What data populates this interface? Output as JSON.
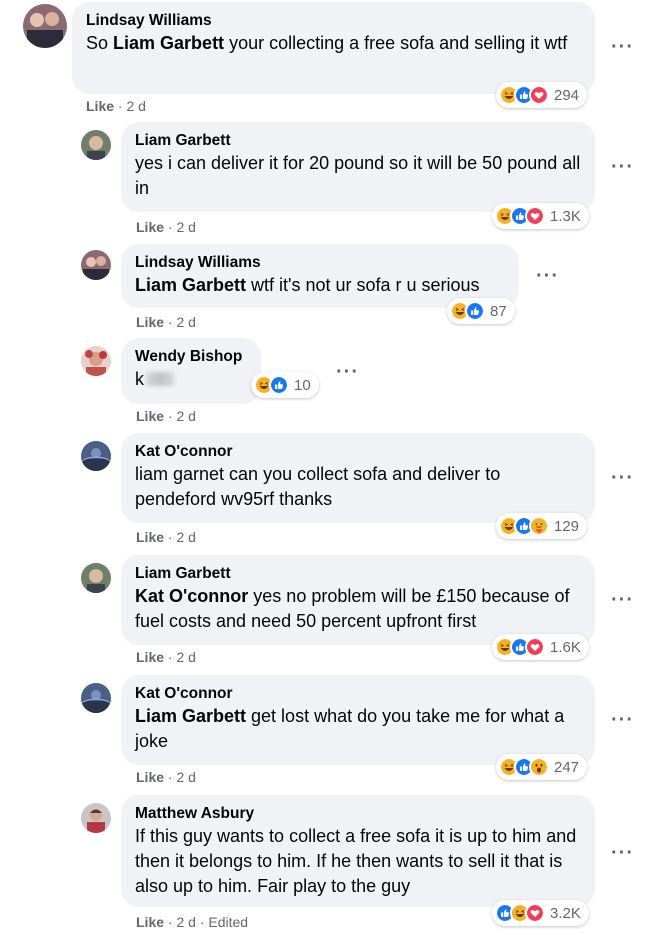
{
  "comments": [
    {
      "author": "Lindsay Williams",
      "mention": "Liam Garbett",
      "text_before": "So ",
      "text_after": " your collecting a free sofa and selling it wtf",
      "like_label": "Like",
      "time": "2 d",
      "reaction_count": "294",
      "reactions": [
        "haha-icon",
        "like-icon",
        "love-icon"
      ]
    },
    {
      "author": "Liam Garbett",
      "text": "yes i can deliver it for 20 pound so it will be 50 pound all in",
      "like_label": "Like",
      "time": "2 d",
      "reaction_count": "1.3K",
      "reactions": [
        "haha-icon",
        "like-icon",
        "love-icon"
      ]
    },
    {
      "author": "Lindsay Williams",
      "mention": "Liam Garbett",
      "text_after": " wtf it's not ur sofa r u serious",
      "like_label": "Like",
      "time": "2 d",
      "reaction_count": "87",
      "reactions": [
        "haha-icon",
        "like-icon"
      ]
    },
    {
      "author": "Wendy Bishop",
      "text": "k",
      "like_label": "Like",
      "time": "2 d",
      "reaction_count": "10",
      "reactions": [
        "haha-icon",
        "like-icon"
      ]
    },
    {
      "author": "Kat O'connor",
      "text": "liam garnet can you collect sofa and deliver to pendeford wv95rf thanks",
      "like_label": "Like",
      "time": "2 d",
      "reaction_count": "129",
      "reactions": [
        "haha-icon",
        "like-icon",
        "care-icon"
      ]
    },
    {
      "author": "Liam Garbett",
      "mention": "Kat O'connor",
      "text_after": " yes no problem will be £150 because of fuel costs and need 50 percent upfront first",
      "like_label": "Like",
      "time": "2 d",
      "reaction_count": "1.6K",
      "reactions": [
        "haha-icon",
        "like-icon",
        "love-icon"
      ]
    },
    {
      "author": "Kat O'connor",
      "mention": "Liam Garbett",
      "text_after": " get lost what do you take me for what a joke",
      "like_label": "Like",
      "time": "2 d",
      "reaction_count": "247",
      "reactions": [
        "haha-icon",
        "like-icon",
        "wow-icon"
      ]
    },
    {
      "author": "Matthew Asbury",
      "text": "If this guy wants to collect a free sofa it is up to him and then it belongs to him. If he then wants to sell it that is also up to him. Fair play to the guy",
      "like_label": "Like",
      "time": "2 d",
      "edited": "Edited",
      "reaction_count": "3.2K",
      "reactions": [
        "like-icon",
        "haha-icon",
        "love-icon"
      ]
    }
  ],
  "separator": "·",
  "more_icon": "more-options-icon",
  "colors": {
    "like_blue": "#1877f2",
    "love_red": "#f33e58",
    "haha_yellow": "#f7b125",
    "bubble_bg": "#f0f2f5",
    "meta_gray": "#65676b"
  }
}
